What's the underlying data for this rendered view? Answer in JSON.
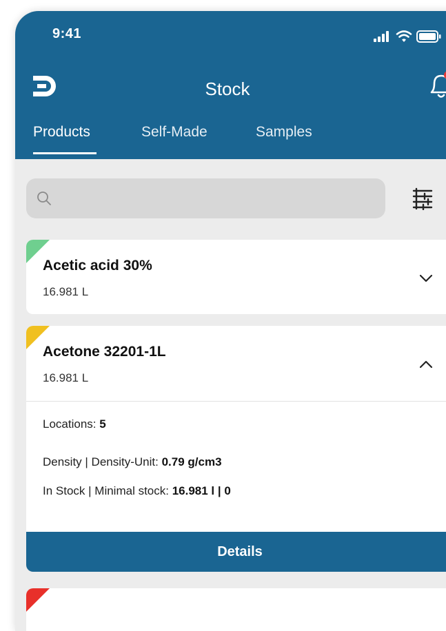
{
  "status_bar": {
    "time": "9:41"
  },
  "header": {
    "title": "Stock"
  },
  "tabs": [
    {
      "label": "Products",
      "active": true
    },
    {
      "label": "Self-Made",
      "active": false
    },
    {
      "label": "Samples",
      "active": false
    }
  ],
  "search": {
    "placeholder": ""
  },
  "products": [
    {
      "name": "Acetic acid 30%",
      "quantity": "16.981 L",
      "status_color": "#6fcf8f",
      "expanded": false
    },
    {
      "name": "Acetone 32201-1L",
      "quantity": "16.981 L",
      "status_color": "#f0c020",
      "expanded": true,
      "locations_label": "Locations: ",
      "locations_value": "5",
      "density_label": "Density | Density-Unit: ",
      "density_value": "0.79 g/cm3",
      "stock_label": "In Stock | Minimal stock: ",
      "stock_value": "16.981 l | 0",
      "details_label": "Details"
    },
    {
      "status_color": "#e8302a"
    }
  ],
  "colors": {
    "brand": "#1a6592",
    "notification_dot": "#e53935"
  }
}
